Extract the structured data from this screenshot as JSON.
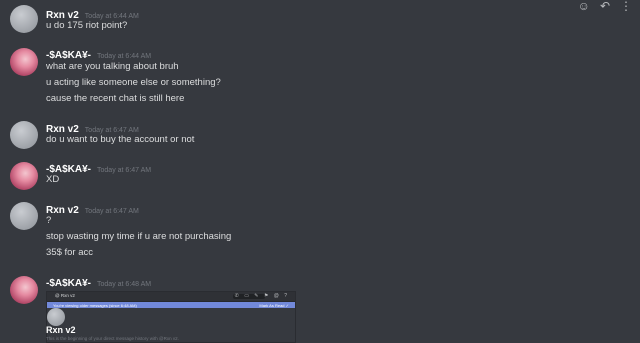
{
  "toolbar": {
    "icons": [
      "add-reaction-icon",
      "reply-icon",
      "more-icon"
    ],
    "add_reaction_glyph": "☺",
    "reply_glyph": "↶",
    "more_glyph": "⋮"
  },
  "messages": [
    {
      "author": "Rxn v2",
      "timestamp": "Today at 6:44 AM",
      "avatar_color": "#9ea2a8",
      "lines": [
        "u do 175 riot point?"
      ]
    },
    {
      "author": "-$A$KA¥-",
      "timestamp": "Today at 6:44 AM",
      "avatar_color": "#e58aa1",
      "lines": [
        "what are you talking about bruh",
        "u acting like someone else or something?",
        "cause the recent chat is still here"
      ]
    },
    {
      "author": "Rxn v2",
      "timestamp": "Today at 6:47 AM",
      "avatar_color": "#9ea2a8",
      "lines": [
        "do u want to buy the account or not"
      ]
    },
    {
      "author": "-$A$KA¥-",
      "timestamp": "Today at 6:47 AM",
      "avatar_color": "#e58aa1",
      "lines": [
        "XD"
      ]
    },
    {
      "author": "Rxn v2",
      "timestamp": "Today at 6:47 AM",
      "avatar_color": "#9ea2a8",
      "lines": [
        "?",
        "stop wasting my time if u are not purchasing",
        "35$ for acc"
      ]
    },
    {
      "author": "-$A$KA¥-",
      "timestamp": "Today at 6:48 AM",
      "avatar_color": "#e58aa1",
      "lines": []
    }
  ],
  "embed": {
    "bar_title": "@ Rxn v2",
    "bar_icons": "✆ ▭ ✎ ⚑ @ ?",
    "banner_left": "You're viewing older messages (since 6:48 AM)",
    "banner_right": "Mark As Read ✓",
    "author": "Rxn v2",
    "subtitle": "This is the beginning of your direct message history with @Rxn v2."
  },
  "colors": {
    "background": "#36393f",
    "username": "#ffffff",
    "timestamp": "#72767d",
    "text": "#dcddde",
    "banner": "#7289da"
  }
}
